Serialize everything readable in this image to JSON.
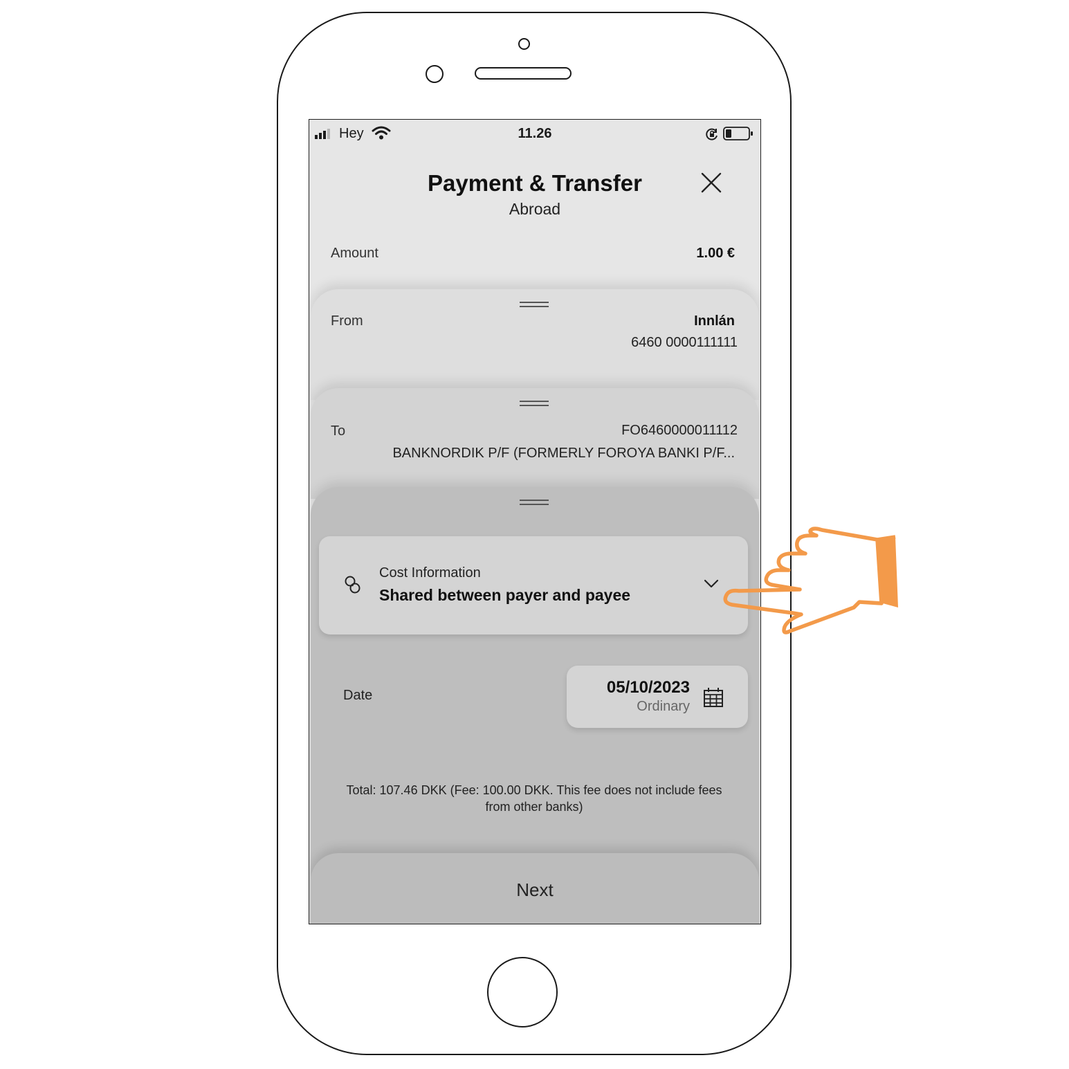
{
  "status_bar": {
    "carrier": "Hey",
    "time": "11.26"
  },
  "header": {
    "title": "Payment & Transfer",
    "subtitle": "Abroad"
  },
  "amount": {
    "label": "Amount",
    "value": "1.00 €"
  },
  "from": {
    "label": "From",
    "account_name": "Innlán",
    "account_number": "6460 0000111111"
  },
  "to": {
    "label": "To",
    "iban": "FO6460000011112",
    "bank_name": "BANKNORDIK P/F (FORMERLY FOROYA BANKI P/F..."
  },
  "cost_information": {
    "label": "Cost Information",
    "value": "Shared between payer and payee"
  },
  "date": {
    "label": "Date",
    "value": "05/10/2023",
    "type": "Ordinary"
  },
  "total_text": "Total: 107.46 DKK (Fee: 100.00 DKK. This fee does not include fees from other banks)",
  "next_label": "Next",
  "colors": {
    "hand_pointer": "#f39a4a"
  },
  "icons": [
    "signal-icon",
    "wifi-icon",
    "orientation-lock-icon",
    "battery-icon",
    "close-icon",
    "coins-icon",
    "chevron-down-icon",
    "calendar-icon",
    "pointing-hand-icon"
  ]
}
